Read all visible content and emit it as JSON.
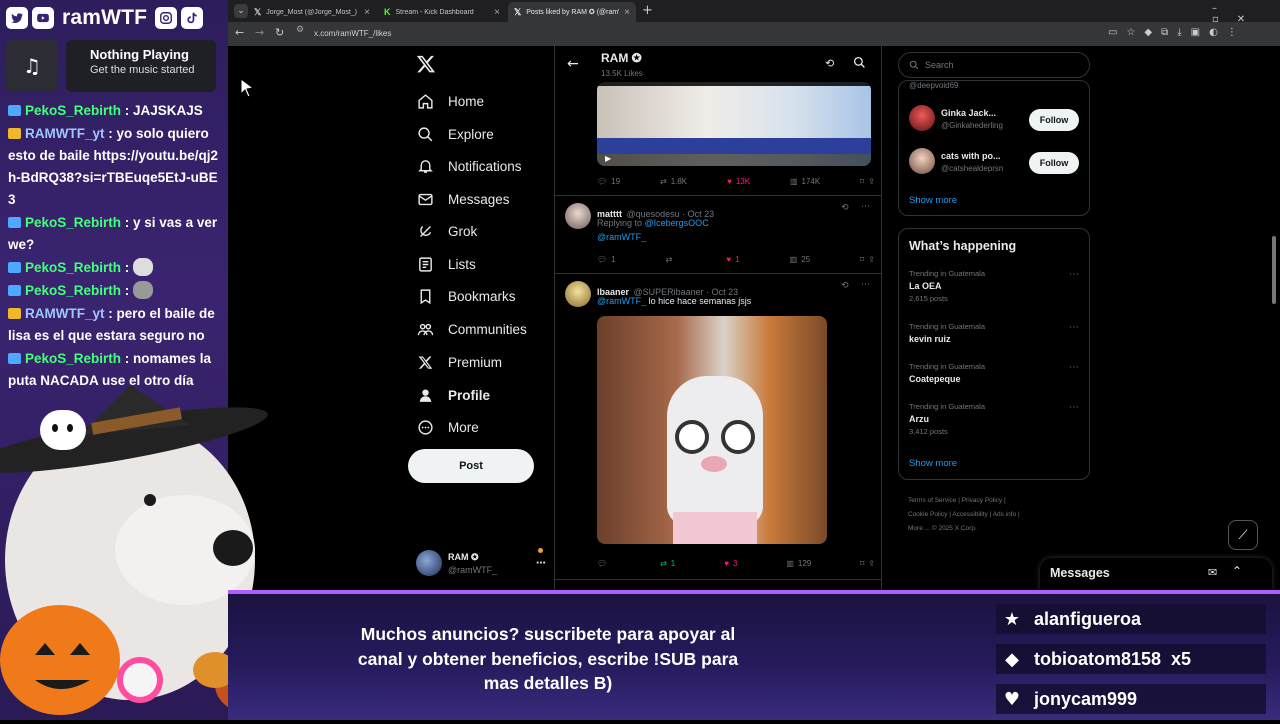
{
  "overlay": {
    "brand_name": "ramWTF",
    "social_icons": [
      "twitter-icon",
      "youtube-icon",
      "instagram-icon",
      "tiktok-icon"
    ],
    "now_playing": {
      "title": "Nothing Playing",
      "subtitle": "Get the music started"
    },
    "chat": [
      {
        "user": "PekoS_Rebirth",
        "text": "JAJSKAJS",
        "color": "green"
      },
      {
        "user": "RAMWTF_yt",
        "text": "yo solo quiero esto de baile https://youtu.be/qj2h-BdRQ38?si=rTBEuqe5EtJ-uBE3",
        "color": "blue"
      },
      {
        "user": "PekoS_Rebirth",
        "text": "y si vas a ver we?",
        "color": "green"
      },
      {
        "user": "PekoS_Rebirth",
        "text": "",
        "color": "green",
        "emote": true
      },
      {
        "user": "PekoS_Rebirth",
        "text": "",
        "color": "green",
        "emote": true
      },
      {
        "user": "RAMWTF_yt",
        "text": "pero el baile de lisa es el que estara seguro no",
        "color": "blue"
      },
      {
        "user": "PekoS_Rebirth",
        "text": "nomames la puta NACADA   use el otro día",
        "color": "green"
      }
    ]
  },
  "browser": {
    "tabs": [
      {
        "label": "Jorge_Most (@Jorge_Most_) / X",
        "active": false
      },
      {
        "label": "Stream - Kick Dashboard",
        "active": false
      },
      {
        "label": "Posts liked by RAM ✪ (@ramW",
        "active": true
      }
    ],
    "url": "x.com/ramWTF_/likes"
  },
  "x": {
    "nav": [
      {
        "label": "Home",
        "icon": "home-icon"
      },
      {
        "label": "Explore",
        "icon": "search-icon"
      },
      {
        "label": "Notifications",
        "icon": "bell-icon"
      },
      {
        "label": "Messages",
        "icon": "mail-icon"
      },
      {
        "label": "Grok",
        "icon": "grok-icon"
      },
      {
        "label": "Lists",
        "icon": "list-icon"
      },
      {
        "label": "Bookmarks",
        "icon": "bookmark-icon"
      },
      {
        "label": "Communities",
        "icon": "communities-icon"
      },
      {
        "label": "Premium",
        "icon": "x-icon"
      },
      {
        "label": "Profile",
        "icon": "profile-icon"
      },
      {
        "label": "More",
        "icon": "more-icon"
      }
    ],
    "post_button": "Post",
    "account": {
      "name": "RAM ✪",
      "handle": "@ramWTF_"
    },
    "header": {
      "name": "RAM ✪",
      "likes": "13.5K Likes"
    },
    "tweets": [
      {
        "stats": {
          "replies": "19",
          "reposts": "1.8K",
          "likes": "13K",
          "views": "174K"
        }
      },
      {
        "name": "matttt",
        "handle": "@quesodesu · Oct 23",
        "reply_prefix": "Replying to ",
        "reply_to": "@IcebergsOOC",
        "mention": "@ramWTF_",
        "stats": {
          "replies": "1",
          "reposts": "",
          "likes": "1",
          "views": "25"
        }
      },
      {
        "name": "lbaaner",
        "handle": "@SUPERibaaner · Oct 23",
        "mention": "@ramWTF_",
        "text": "lo hice hace semanas jsjs",
        "stats": {
          "replies": "",
          "reposts": "1",
          "likes": "3",
          "views": "129"
        }
      }
    ],
    "search_placeholder": "Search",
    "who_to_follow": [
      {
        "name": "@deepvoid69",
        "handle": ""
      },
      {
        "name": "Ginka Jack...",
        "handle": "@Ginkahederling",
        "follow": "Follow"
      },
      {
        "name": "cats with po...",
        "handle": "@catshealdeprsn",
        "follow": "Follow"
      }
    ],
    "show_more": "Show more",
    "whats_happening": "What’s happening",
    "trends": [
      {
        "context": "Trending in Guatemala",
        "name": "La OEA",
        "count": "2,615 posts"
      },
      {
        "context": "Trending in Guatemala",
        "name": "kevin ruiz",
        "count": ""
      },
      {
        "context": "Trending in Guatemala",
        "name": "Coatepeque",
        "count": ""
      },
      {
        "context": "Trending in Guatemala",
        "name": "Arzu",
        "count": "3,412 posts"
      }
    ],
    "footer": [
      "Terms of Service",
      "Privacy Policy",
      "Cookie Policy",
      "Accessibility",
      "Ads info",
      "More ...",
      "© 2025 X Corp."
    ],
    "messages_dock": "Messages"
  },
  "banner": {
    "text": "Muchos anuncios? suscribete para apoyar al canal y obtener beneficios, escribe !SUB para mas detalles B)",
    "subs": [
      {
        "name": "alanfigueroa",
        "icon": "star-icon"
      },
      {
        "name": "tobioatom8158  x5",
        "icon": "diamond-icon"
      },
      {
        "name": "jonycam999",
        "icon": "heart-icon"
      }
    ]
  },
  "colors": {
    "accent": "#1d9bf0",
    "like": "#f91880",
    "repost": "#00ba7c",
    "banner_border": "#b15cff",
    "chat_green": "#44ff7b"
  }
}
